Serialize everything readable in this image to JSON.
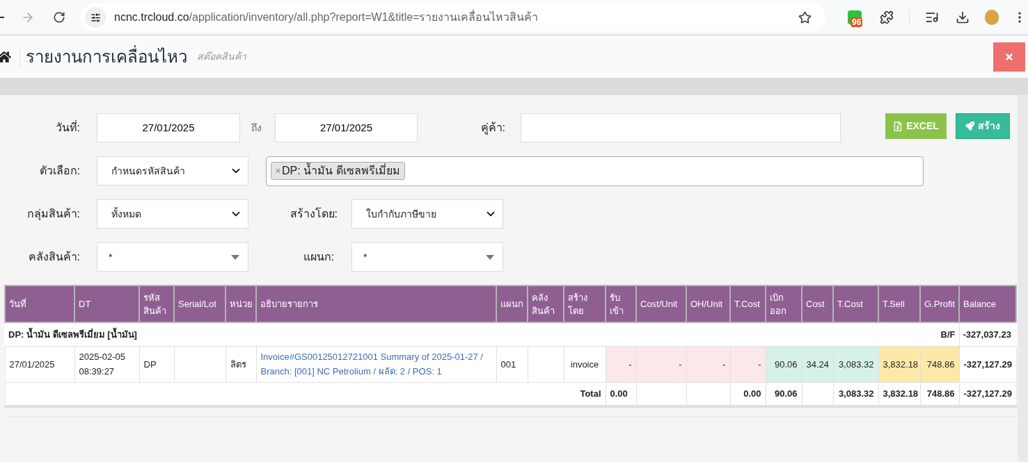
{
  "browser": {
    "url_host": "ncnc.trcloud.co",
    "url_path": "/application/inventory/all.php?report=W1&title=รายงานเคลื่อนไหวสินค้า",
    "extension_badge": "96"
  },
  "header": {
    "title": "รายงานการเคลื่อนไหว",
    "subtitle": "สต๊อคสินค้า"
  },
  "filters": {
    "date": {
      "label": "วันที่:",
      "from": "27/01/2025",
      "to_label": "ถึง",
      "to": "27/01/2025"
    },
    "partner": {
      "label": "คู่ค้า:"
    },
    "option": {
      "label": "ตัวเลือก:",
      "value": "กำหนดรหัสสินค้า",
      "kind": "dropdown"
    },
    "product_tags": [
      {
        "label": "DP: น้ำมัน ดีเซลพรีเมี่ยม",
        "remove": "×"
      }
    ],
    "group": {
      "label": "กลุ่มสินค้า:",
      "value": "ทั้งหมด",
      "kind": "dropdown"
    },
    "created_by": {
      "label": "สร้างโดย:",
      "value": "ใบกำกับภาษีขาย",
      "kind": "dropdown"
    },
    "warehouse": {
      "label": "คลังสินค้า:",
      "value": "*",
      "kind": "combobox"
    },
    "department": {
      "label": "แผนก:",
      "value": "*",
      "kind": "combobox"
    }
  },
  "buttons": [
    {
      "label": "EXCEL",
      "kind": "excel"
    },
    {
      "label": "สร้าง",
      "kind": "create"
    }
  ],
  "table": {
    "columns": [
      {
        "label": "วันที่",
        "kind": "plain"
      },
      {
        "label": "DT",
        "kind": "plain"
      },
      {
        "label": "รหัส สินค้า",
        "kind": "plain"
      },
      {
        "label": "Serial/Lot",
        "kind": "plain"
      },
      {
        "label": "หน่วย",
        "kind": "plain"
      },
      {
        "label": "อธิบายรายการ",
        "kind": "plain"
      },
      {
        "label": "แผนก",
        "kind": "plain"
      },
      {
        "label": "คลัง สินค้า",
        "kind": "plain"
      },
      {
        "label": "สร้าง โดย",
        "kind": "plain"
      },
      {
        "label": "รับ เข้า",
        "kind": "in"
      },
      {
        "label": "Cost/Unit",
        "kind": "in"
      },
      {
        "label": "OH/Unit",
        "kind": "in"
      },
      {
        "label": "T.Cost",
        "kind": "in"
      },
      {
        "label": "เบิก ออก",
        "kind": "out"
      },
      {
        "label": "Cost",
        "kind": "out"
      },
      {
        "label": "T.Cost",
        "kind": "out"
      },
      {
        "label": "T.Sell",
        "kind": "sell"
      },
      {
        "label": "G.Profit",
        "kind": "sell"
      },
      {
        "label": "Balance",
        "kind": "plain"
      }
    ],
    "group_row": {
      "label": "DP: น้ำมัน ดีเซลพรีเมี่ยม [น้ำมัน]",
      "bf_label": "B/F",
      "bf_value": "-327,037.23"
    },
    "rows": [
      {
        "cells": [
          "27/01/2025",
          "2025-02-05 08:39:27",
          "DP",
          null,
          "ลิตร",
          "Invoice#GS00125012721001 Summary of 2025-01-27 / Branch: [001] NC Petrolium / ผลัด: 2 / POS: 1",
          "001",
          null,
          "invoice",
          "-",
          "-",
          "-",
          "-",
          "90.06",
          "34.24",
          "3,083.32",
          "3,832.18",
          "748.86",
          "-327,127.29"
        ]
      }
    ],
    "total": {
      "label": "Total",
      "in_qty": "0.00",
      "in_total_cost": "0.00",
      "out_qty": "90.06",
      "out_total_cost": "3,083.32",
      "total_sell": "3,832.18",
      "gross_profit": "748.86",
      "balance": "-327,127.29"
    }
  }
}
